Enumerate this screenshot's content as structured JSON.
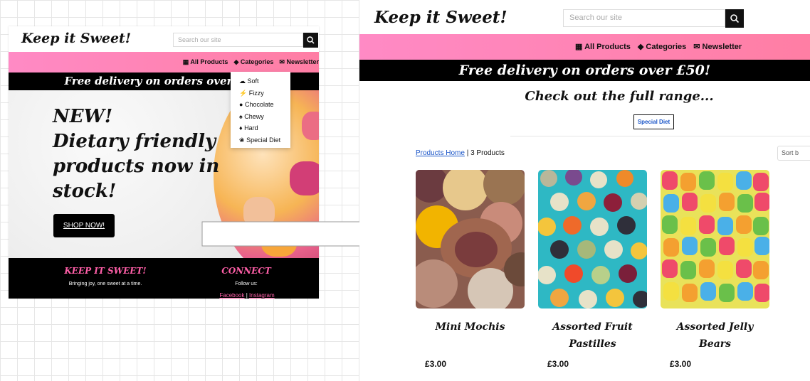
{
  "site": {
    "logo": "Keep it Sweet!",
    "search_placeholder": "Search our site",
    "nav": {
      "all_products": "All Products",
      "categories": "Categories",
      "newsletter": "Newsletter",
      "newsletter_truncated": "Newsletter"
    }
  },
  "left_page": {
    "banner": "Free delivery on orders over £50!",
    "hero_lines": [
      "NEW!",
      "Dietary friendly",
      "products now in",
      "stock!"
    ],
    "shop_button": "SHOP NOW!",
    "dropdown": [
      "Soft",
      "Fizzy",
      "Chocolate",
      "Chewy",
      "Hard",
      "Special Diet"
    ],
    "footer": {
      "brand_title": "KEEP IT SWEET!",
      "brand_tagline": "Bringing joy, one sweet at a time.",
      "connect_title": "CONNECT",
      "follow_text": "Follow us:",
      "facebook": "Facebook",
      "separator": " | ",
      "instagram": "Instagram"
    }
  },
  "right_page": {
    "banner": "Free delivery on orders over £50!",
    "heading": "Check out the full range...",
    "category_tag": "Special Diet",
    "breadcrumb_link": "Products Home",
    "product_count": " | 3 Products",
    "sort_label": "Sort b",
    "products": [
      {
        "name": "Mini Mochis",
        "price": "£3.00"
      },
      {
        "name": "Assorted Fruit Pastilles",
        "price": "£3.00"
      },
      {
        "name": "Assorted Jelly Bears",
        "price": "£3.00"
      }
    ]
  },
  "colors": {
    "nav_pink": "#ff84b4",
    "footer_pink": "#ff5fa8",
    "link_blue": "#1a55c8",
    "black": "#000000"
  },
  "icons": [
    "search-icon",
    "gift-icon",
    "tag-icon",
    "envelope-icon",
    "cloud-icon",
    "bolt-icon",
    "cookie-icon",
    "tooth-icon",
    "gem-icon",
    "leaf-icon"
  ]
}
